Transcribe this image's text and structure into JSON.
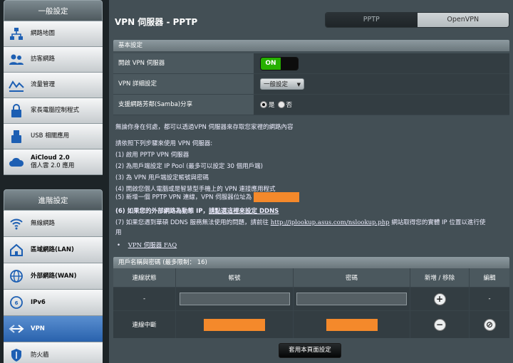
{
  "sidebar": {
    "general_header": "一般設定",
    "general_items": [
      {
        "label": "網路地圖",
        "icon": "network-map-icon"
      },
      {
        "label": "訪客網路",
        "icon": "guest-network-icon"
      },
      {
        "label": "流量管理",
        "icon": "traffic-manager-icon"
      },
      {
        "label": "家長電腦控制程式",
        "icon": "parental-control-icon"
      },
      {
        "label": "USB 相關應用",
        "icon": "usb-icon"
      },
      {
        "label": "AiCloud 2.0",
        "label2": "個人雲 2.0 應用",
        "icon": "aicloud-icon"
      }
    ],
    "advanced_header": "進階設定",
    "advanced_items": [
      {
        "label": "無線網路",
        "icon": "wireless-icon"
      },
      {
        "label": "區域網路(LAN)",
        "icon": "lan-icon"
      },
      {
        "label": "外部網路(WAN)",
        "icon": "wan-icon"
      },
      {
        "label": "IPv6",
        "icon": "ipv6-icon"
      },
      {
        "label": "VPN",
        "icon": "vpn-icon",
        "active": true
      },
      {
        "label": "防火牆",
        "icon": "firewall-icon"
      }
    ]
  },
  "main": {
    "title": "VPN 伺服器 - PPTP",
    "tabs": [
      {
        "label": "PPTP",
        "selected": true
      },
      {
        "label": "OpenVPN",
        "selected": false
      }
    ],
    "basic_section": "基本設定",
    "settings": {
      "enable_label": "開啟 VPN 伺服器",
      "toggle_on": "ON",
      "detail_label": "VPN 詳細設定",
      "detail_value": "一般設定",
      "samba_label": "支援網路芳鄰(Samba)分享",
      "samba_yes": "是",
      "samba_no": "否"
    },
    "description": {
      "intro": "無論你身在何處，都可以透過VPN 伺服器來存取您家裡的網路內容",
      "steps_intro": "請依照下列步驟來使用 VPN 伺服器:",
      "step1": "(1) 啟用 PPTP VPN 伺服器",
      "step2": "(2) 為用戶端設定 IP Pool (最多可以設定 30 個用戶端)",
      "step3": "(3) 為 VPN 用戶端設定帳號與密碼",
      "step4": "(4) 開啟您個人電腦或是智慧型手機上的 VPN 連接應用程式",
      "step5": "(5) 新增一個 PPTP VPN 連線，VPN 伺服器位址為",
      "step6_prefix": "(6) 如果您的外部網路為動態 IP，",
      "step6_link": "請點選這裡來設定 DDNS",
      "step7_prefix": "(7) 如果您遇到華碩 DDNS 服務無法使用的問題，請前往",
      "step7_link": "http://iplookup.asus.com/nslookup.php",
      "step7_suffix": "網站取得您的實體 IP 位置以進行使",
      "step7_cont": "用",
      "faq": "VPN 伺服器 FAQ"
    },
    "user_section": "用戶名稱與密碼 (最多限制： 16)",
    "user_table": {
      "headers": [
        "連線狀態",
        "帳號",
        "密碼",
        "新增 / 移除",
        "編輯"
      ],
      "new_row_status": "-",
      "new_row_edit": "-",
      "rows": [
        {
          "status": "連線中斷"
        }
      ]
    },
    "apply_label": "套用本頁面設定"
  },
  "colors": {
    "accent": "#2962ad",
    "toggle_on": "#26b000",
    "mask": "#f4892b"
  }
}
